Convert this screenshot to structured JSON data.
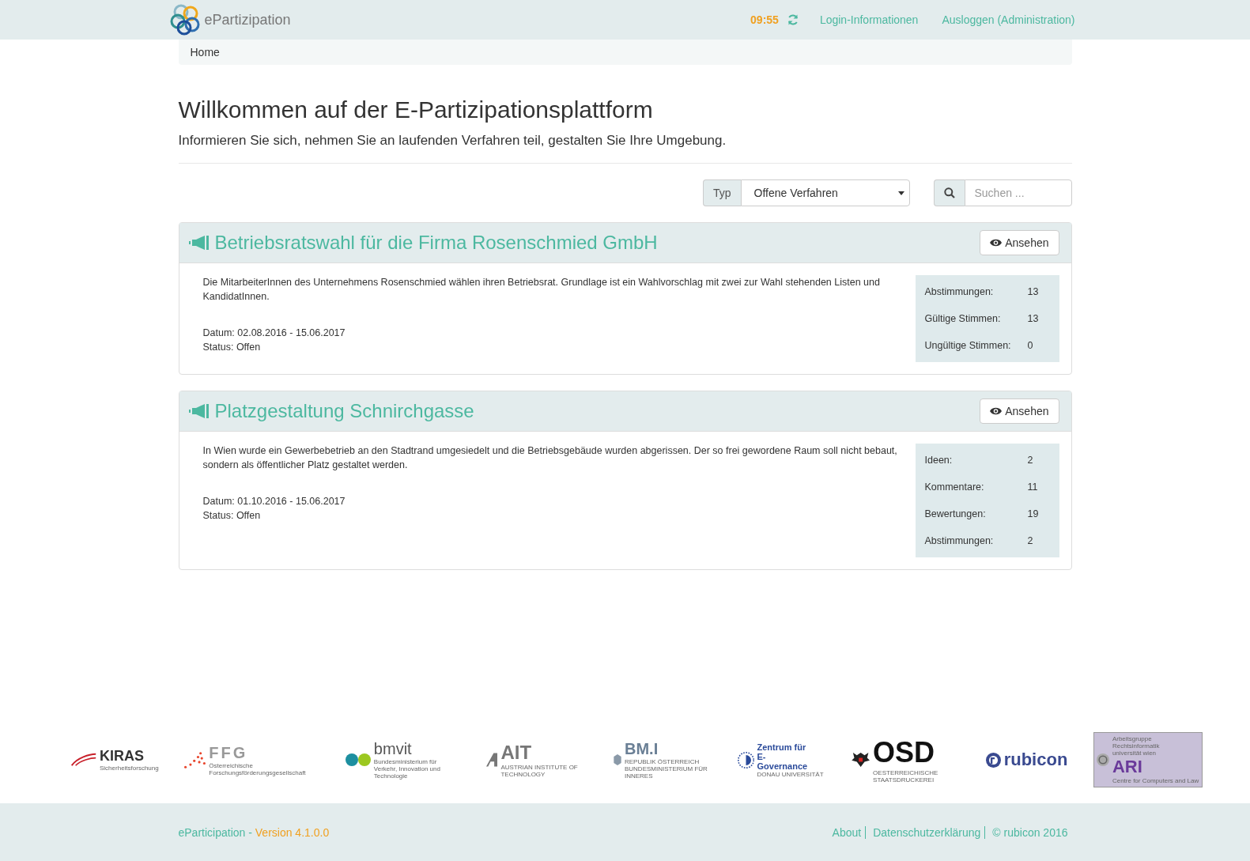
{
  "navbar": {
    "brand": "ePartizipation",
    "timer": "09:55",
    "links": [
      "Login-Informationen",
      "Ausloggen (Administration)"
    ]
  },
  "breadcrumb": [
    "Home"
  ],
  "header": {
    "title": "Willkommen auf der E-Partizipationsplattform",
    "subtitle": "Informieren Sie sich, nehmen Sie an laufenden Verfahren teil, gestalten Sie Ihre Umgebung."
  },
  "filter": {
    "label": "Typ",
    "value": "Offene Verfahren",
    "search_placeholder": "Suchen ..."
  },
  "procedures": [
    {
      "title": "Betriebsratswahl für die Firma Rosenschmied GmbH",
      "button": "Ansehen",
      "description": "Die MitarbeiterInnen des Unternehmens Rosenschmied wählen ihren Betriebsrat. Grundlage ist ein Wahlvorschlag mit zwei zur Wahl stehenden Listen und KandidatInnen.",
      "date": "Datum: 02.08.2016 - 15.06.2017",
      "status": "Status: Offen",
      "stats": [
        {
          "label": "Abstimmungen:",
          "value": "13"
        },
        {
          "label": "Gültige Stimmen:",
          "value": "13"
        },
        {
          "label": "Ungültige Stimmen:",
          "value": "0"
        }
      ]
    },
    {
      "title": "Platzgestaltung Schnirchgasse",
      "button": "Ansehen",
      "description": "In Wien wurde ein Gewerbebetrieb an den Stadtrand umgesiedelt und die Betriebsgebäude wurden abgerissen. Der so frei gewordene Raum soll nicht bebaut, sondern als öffentlicher Platz gestaltet werden.",
      "date": "Datum: 01.10.2016 - 15.06.2017",
      "status": "Status: Offen",
      "stats": [
        {
          "label": "Ideen:",
          "value": "2"
        },
        {
          "label": "Kommentare:",
          "value": "11"
        },
        {
          "label": "Bewertungen:",
          "value": "19"
        },
        {
          "label": "Abstimmungen:",
          "value": "2"
        }
      ]
    }
  ],
  "partner_logos": [
    {
      "kind": "kiras",
      "title": "KIRAS",
      "subtitle": "Sicherheitsforschung"
    },
    {
      "kind": "ffg",
      "title": "FFG",
      "subtitle": "Österreichische Forschungsförderungsgesellschaft"
    },
    {
      "kind": "bmvit",
      "title": "bmvit",
      "subtitle": "Bundesministerium für Verkehr, Innovation und Technologie"
    },
    {
      "kind": "ait",
      "title": "AIT",
      "subtitle": "AUSTRIAN INSTITUTE OF TECHNOLOGY"
    },
    {
      "kind": "bmi",
      "title": "BM.I",
      "subtitle": "REPUBLIK ÖSTERREICH BUNDESMINISTERIUM FÜR INNERES"
    },
    {
      "kind": "egov",
      "title": "Zentrum für E-Governance",
      "subtitle": "DONAU UNIVERSITÄT"
    },
    {
      "kind": "osd",
      "title": "OSD",
      "subtitle": "OESTERREICHISCHE STAATSDRUCKEREI"
    },
    {
      "kind": "rubicon",
      "title": "rubicon"
    },
    {
      "kind": "ari",
      "title": "ARI",
      "subtitle": "Arbeitsgruppe Rechtsinformatik",
      "extra": "universität wien",
      "footer": "Centre for Computers and Law"
    }
  ],
  "footer": {
    "app": "eParticipation - ",
    "version": "Version 4.1.0.0",
    "links": [
      "About",
      "Datenschutzerklärung",
      "© rubicon 2016"
    ]
  }
}
